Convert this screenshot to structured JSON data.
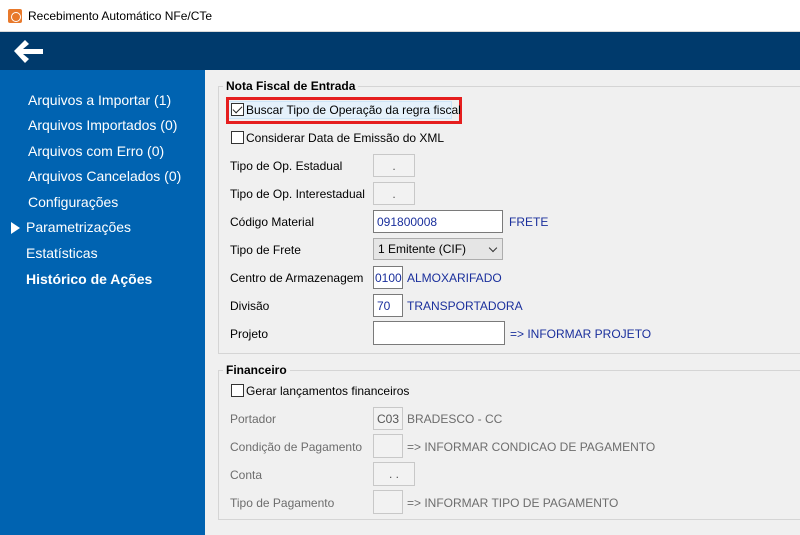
{
  "window": {
    "title": "Recebimento Automático NFe/CTe"
  },
  "sidebar": {
    "items": [
      {
        "label": "Arquivos a Importar (1)"
      },
      {
        "label": "Arquivos Importados (0)"
      },
      {
        "label": "Arquivos com Erro (0)"
      },
      {
        "label": "Arquivos Cancelados (0)"
      },
      {
        "label": "Configurações"
      },
      {
        "label": "Parametrizações"
      },
      {
        "label": "Estatísticas"
      },
      {
        "label": "Histórico de Ações"
      }
    ]
  },
  "nota_fiscal": {
    "title": "Nota Fiscal de Entrada",
    "buscar_tipo_label": "Buscar Tipo de Operação da regra fiscal",
    "buscar_tipo_checked": true,
    "considerar_data_label": "Considerar Data de Emissão do XML",
    "considerar_data_checked": false,
    "tipo_op_estadual_label": "Tipo de Op. Estadual",
    "tipo_op_estadual_value": ".",
    "tipo_op_interestadual_label": "Tipo de Op. Interestadual",
    "tipo_op_interestadual_value": ".",
    "codigo_material_label": "Código Material",
    "codigo_material_value": "091800008",
    "codigo_material_desc": "FRETE",
    "tipo_frete_label": "Tipo de Frete",
    "tipo_frete_value": "1 Emitente (CIF)",
    "centro_label": "Centro de Armazenagem",
    "centro_value": "0100",
    "centro_desc": "ALMOXARIFADO",
    "divisao_label": "Divisão",
    "divisao_value": "70",
    "divisao_desc": "TRANSPORTADORA",
    "projeto_label": "Projeto",
    "projeto_value": "",
    "projeto_desc": "=> INFORMAR PROJETO"
  },
  "financeiro": {
    "title": "Financeiro",
    "gerar_label": "Gerar lançamentos financeiros",
    "gerar_checked": false,
    "portador_label": "Portador",
    "portador_value": "C03",
    "portador_desc": "BRADESCO - CC",
    "condicao_label": "Condição de Pagamento",
    "condicao_value": "",
    "condicao_desc": "=> INFORMAR CONDICAO DE PAGAMENTO",
    "conta_label": "Conta",
    "conta_value": ". .",
    "tipo_pag_label": "Tipo de Pagamento",
    "tipo_pag_value": "",
    "tipo_pag_desc": "=> INFORMAR TIPO DE PAGAMENTO"
  },
  "colors": {
    "sidebar": "#0063b1",
    "topbar": "#003a6c",
    "highlight": "#e51e1e",
    "link_blue": "#1a2f9c"
  },
  "icons": [
    "app-icon",
    "back-arrow-icon",
    "expand-triangle-icon",
    "checkbox-checked-icon",
    "chevron-down-icon"
  ]
}
